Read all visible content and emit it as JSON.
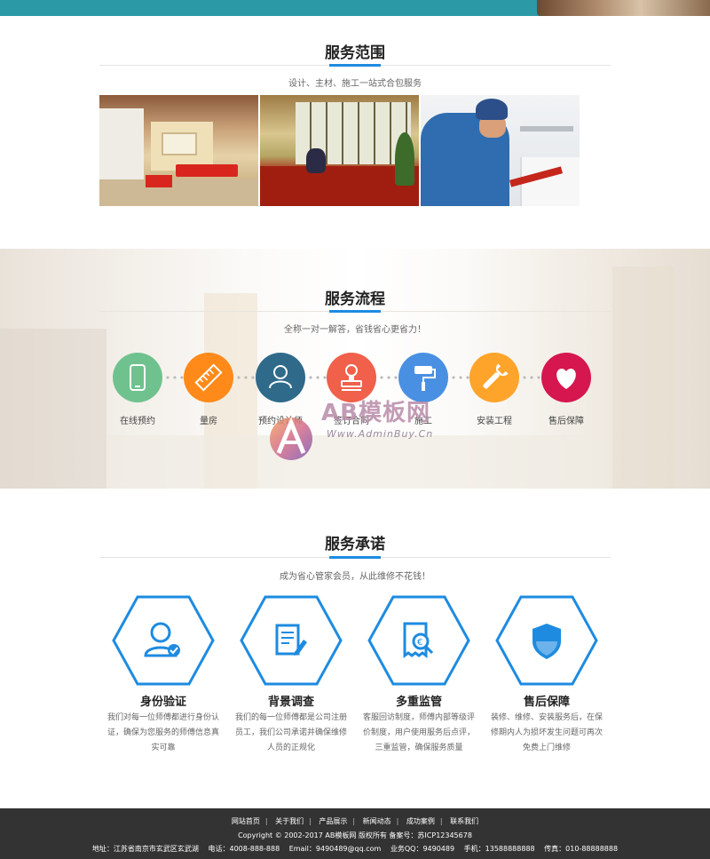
{
  "colors": {
    "accent": "#1e8be0",
    "header_strip": "#2b9aa6",
    "footer_bg": "#333333",
    "hex_stroke": "#1e8be0",
    "step_colors": [
      "#6fc28e",
      "#ff8a1a",
      "#2f6a8a",
      "#f0604a",
      "#4a90e2",
      "#ffa42a",
      "#d6164f"
    ]
  },
  "scope": {
    "title": "服务范围",
    "subtitle": "设计、主材、施工一站式合包服务"
  },
  "process": {
    "title": "服务流程",
    "subtitle": "全称一对一解答，省钱省心更省力！",
    "steps": [
      {
        "label": "在线预约",
        "icon": "phone-icon"
      },
      {
        "label": "量房",
        "icon": "ruler-icon"
      },
      {
        "label": "预约设计师",
        "icon": "designer-icon"
      },
      {
        "label": "签订合同",
        "icon": "stamp-icon"
      },
      {
        "label": "施工",
        "icon": "paint-roller-icon"
      },
      {
        "label": "安装工程",
        "icon": "wrench-icon"
      },
      {
        "label": "售后保障",
        "icon": "heart-icon"
      }
    ]
  },
  "watermark": {
    "text": "AB模板网",
    "url": "Www.AdminBuy.Cn"
  },
  "promise": {
    "title": "服务承诺",
    "subtitle": "成为省心管家会员，从此维修不花钱！",
    "items": [
      {
        "title": "身份验证",
        "icon": "identity-check-icon",
        "desc": "我们对每一位师傅都进行身份认证，确保为您服务的师傅信息真实可靠"
      },
      {
        "title": "背景调查",
        "icon": "document-edit-icon",
        "desc": "我们的每一位师傅都是公司注册员工，我们公司承诺并确保维修人员的正规化"
      },
      {
        "title": "多重监管",
        "icon": "receipt-search-icon",
        "desc": "客服回访制度，师傅内部等级评价制度，用户使用服务后点评，三重监管，确保服务质量"
      },
      {
        "title": "售后保障",
        "icon": "shield-icon",
        "desc": "装修、维修、安装服务后，在保修期内人为损坏发生问题可再次免费上门维修"
      }
    ]
  },
  "footer": {
    "nav": [
      "网站首页",
      "关于我们",
      "产品展示",
      "新闻动态",
      "成功案例",
      "联系我们"
    ],
    "separator": "|",
    "copyright": "Copyright © 2002-2017 AB模板网 版权所有 备案号：苏ICP12345678",
    "contact": [
      "地址：江苏省南京市玄武区玄武湖",
      "电话：4008-888-888",
      "Email：9490489@qq.com",
      "业务QQ：9490489",
      "手机：13588888888",
      "传真：010-88888888"
    ]
  }
}
